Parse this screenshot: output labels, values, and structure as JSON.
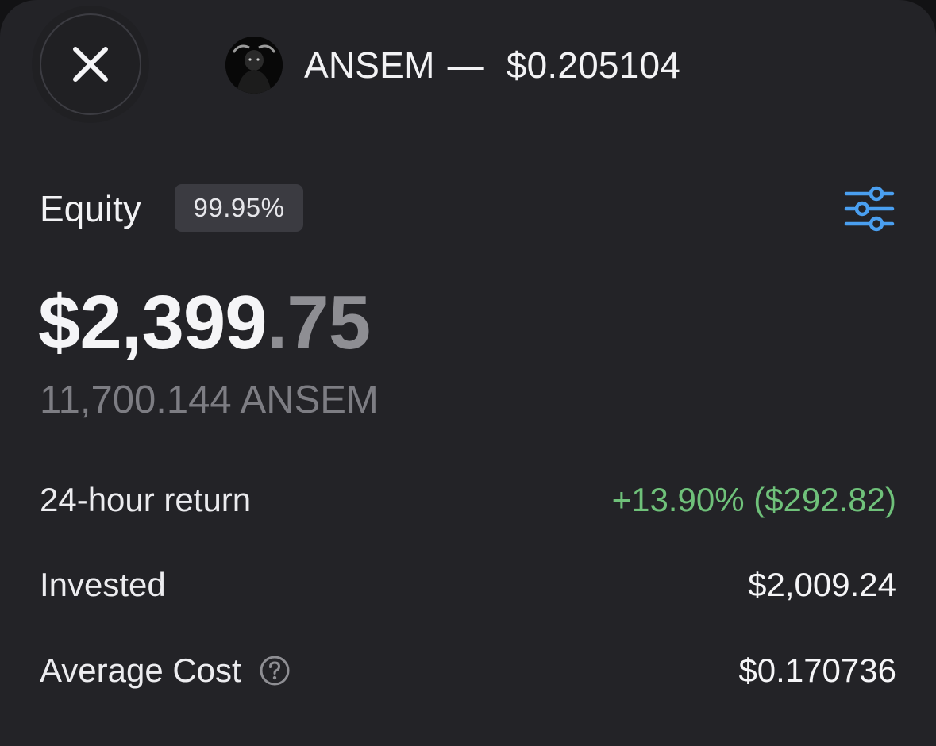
{
  "header": {
    "close_icon": "close-icon",
    "avatar_icon": "bull-avatar-icon",
    "token_symbol": "ANSEM",
    "separator": "—",
    "price": "$0.205104"
  },
  "equity": {
    "label": "Equity",
    "percent_badge": "99.95%",
    "settings_icon": "sliders-icon",
    "accent_color": "#4a9ff0"
  },
  "balance": {
    "whole": "$2,399",
    "cents": ".75",
    "token_amount": "11,700.144 ANSEM"
  },
  "stats": [
    {
      "label": "24-hour return",
      "value": "+13.90% ($292.82)",
      "color": "#6fc17a"
    },
    {
      "label": "Invested",
      "value": "$2,009.24"
    },
    {
      "label": "Average Cost",
      "value": "$0.170736",
      "help_icon": "question-circle-icon"
    }
  ]
}
